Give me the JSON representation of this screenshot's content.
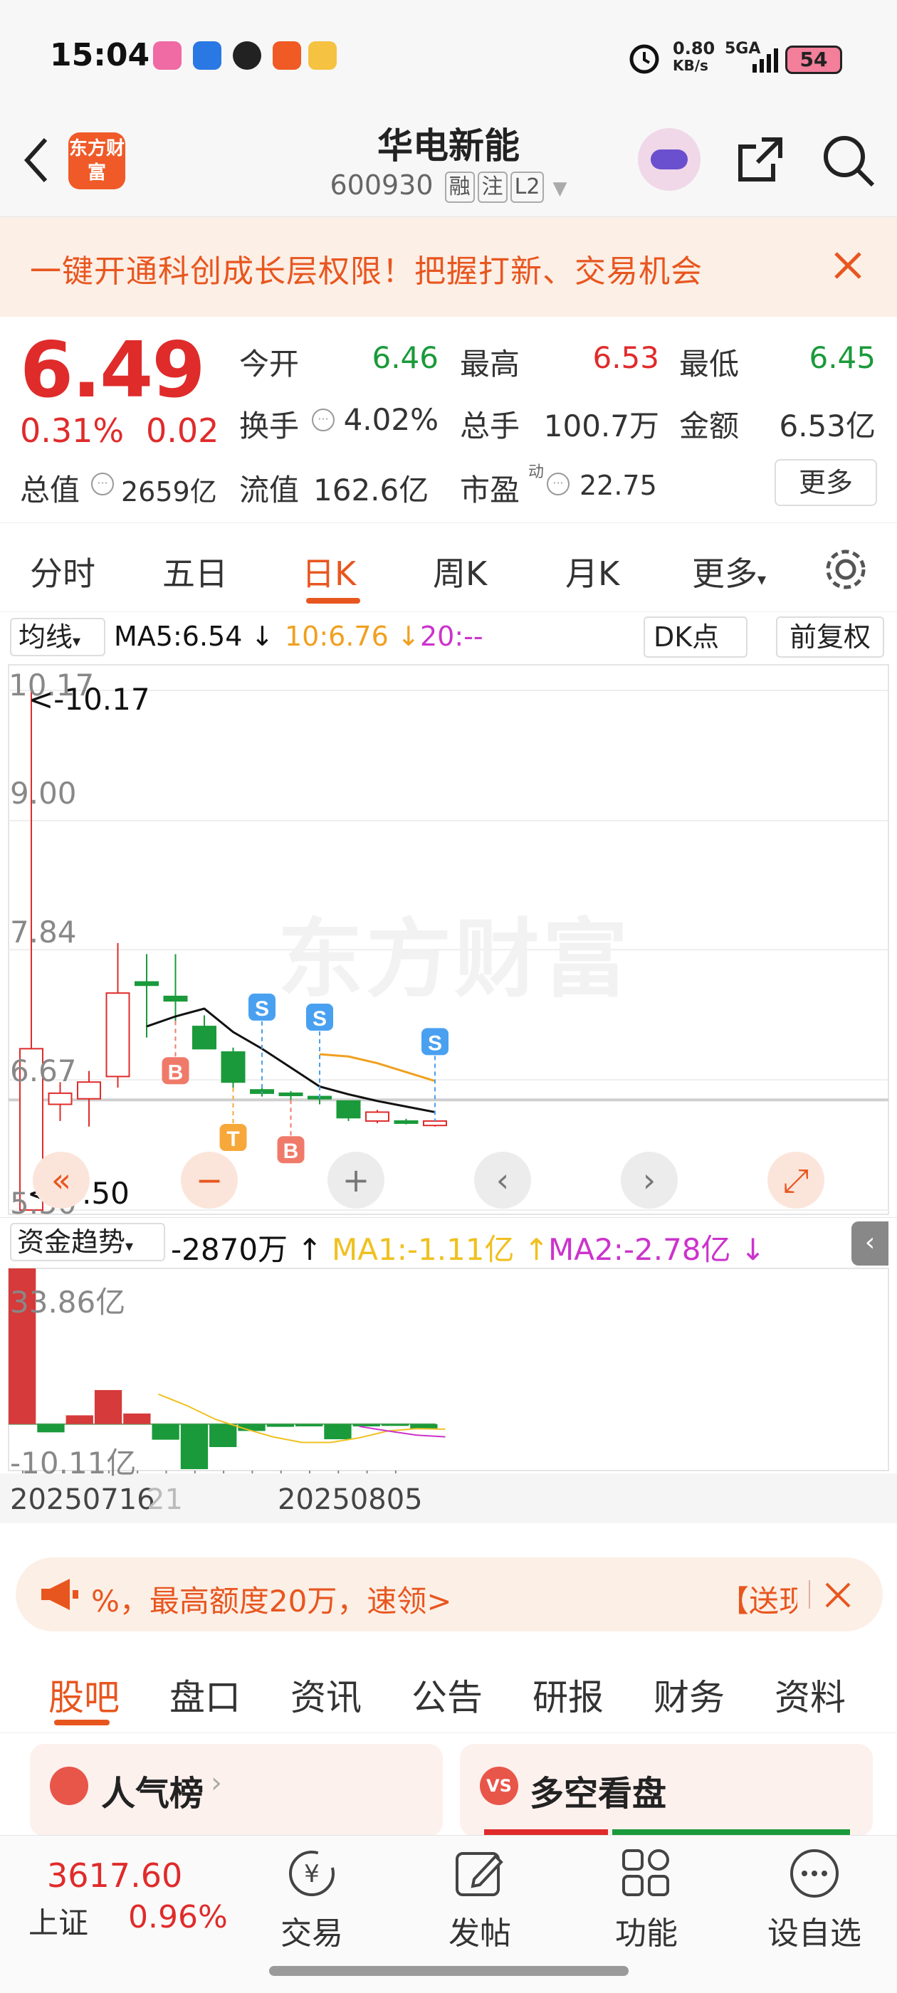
{
  "status_bar": {
    "time": "15:04",
    "net_speed": "0.80",
    "net_unit": "KB/s",
    "signal": "5GA",
    "battery": "54"
  },
  "header": {
    "stock_name": "华电新能",
    "stock_code": "600930",
    "tags": [
      "融",
      "注",
      "L2"
    ],
    "logo_text": "东方财富"
  },
  "banner": {
    "text": "一键开通科创成长层权限！把握打新、交易机会"
  },
  "quote": {
    "price": "6.49",
    "change_pct": "0.31%",
    "change": "0.02",
    "open_label": "今开",
    "open": "6.46",
    "high_label": "最高",
    "high": "6.53",
    "low_label": "最低",
    "low": "6.45",
    "turnover_label": "换手",
    "turnover": "4.02%",
    "volume_label": "总手",
    "volume": "100.7万",
    "amount_label": "金额",
    "amount": "6.53亿",
    "mktcap_label": "总值",
    "mktcap": "2659亿",
    "float_label": "流值",
    "float": "162.6亿",
    "pe_label": "市盈",
    "pe_sup": "动",
    "pe": "22.75",
    "more": "更多"
  },
  "chart_tabs": [
    "分时",
    "五日",
    "日K",
    "周K",
    "月K",
    "更多"
  ],
  "chart_tabs_active": "日K",
  "ma_bar": {
    "selector": "均线",
    "ma5": "MA5:6.54",
    "ma10": "10:6.76",
    "ma20": "20:--",
    "dk": "DK点",
    "adjust": "前复权"
  },
  "kline": {
    "y_ticks": [
      "10.17",
      "9.00",
      "7.84",
      "6.67",
      "5.50"
    ],
    "max_label": "<-10.17",
    "min_label": "<-5.50",
    "watermark": "东方财富",
    "markers": {
      "buy": "B",
      "sell": "S",
      "t": "T"
    },
    "controls": [
      "«",
      "−",
      "+",
      "‹",
      "›",
      "⤢"
    ]
  },
  "fund_bar": {
    "selector": "资金趋势",
    "value": "-2870万",
    "ma1": "MA1:-1.11亿",
    "ma2": "MA2:-2.78亿"
  },
  "fund_chart": {
    "top_label": "33.86亿",
    "bottom_label": "-10.11亿",
    "date_start": "20250716",
    "date_start_tail": "21",
    "date_mid": "20250805"
  },
  "chart_data": [
    {
      "type": "candlestick",
      "ylim": [
        5.5,
        10.17
      ],
      "y_ticks": [
        10.17,
        9.0,
        7.84,
        6.67,
        5.5
      ],
      "candles": [
        {
          "o": 5.5,
          "h": 10.17,
          "l": 5.5,
          "c": 6.95
        },
        {
          "o": 6.45,
          "h": 6.65,
          "l": 6.3,
          "c": 6.55
        },
        {
          "o": 6.5,
          "h": 6.75,
          "l": 6.25,
          "c": 6.65
        },
        {
          "o": 6.7,
          "h": 7.9,
          "l": 6.6,
          "c": 7.45
        },
        {
          "o": 7.55,
          "h": 7.8,
          "l": 7.05,
          "c": 7.52
        },
        {
          "o": 7.42,
          "h": 7.8,
          "l": 7.2,
          "c": 7.38
        },
        {
          "o": 7.15,
          "h": 7.25,
          "l": 6.95,
          "c": 6.95
        },
        {
          "o": 6.92,
          "h": 6.96,
          "l": 6.6,
          "c": 6.65
        },
        {
          "o": 6.58,
          "h": 6.62,
          "l": 6.52,
          "c": 6.55
        },
        {
          "o": 6.55,
          "h": 6.57,
          "l": 6.49,
          "c": 6.53
        },
        {
          "o": 6.52,
          "h": 6.53,
          "l": 6.45,
          "c": 6.5
        },
        {
          "o": 6.48,
          "h": 6.48,
          "l": 6.3,
          "c": 6.33
        },
        {
          "o": 6.3,
          "h": 6.4,
          "l": 6.28,
          "c": 6.38
        },
        {
          "o": 6.3,
          "h": 6.32,
          "l": 6.27,
          "c": 6.29
        },
        {
          "o": 6.26,
          "h": 6.31,
          "l": 6.25,
          "c": 6.3
        }
      ],
      "ma5": [
        null,
        null,
        null,
        null,
        7.15,
        7.24,
        7.31,
        7.1,
        6.95,
        6.78,
        6.61,
        6.54,
        6.48,
        6.43,
        6.38
      ],
      "ma10": [
        null,
        null,
        null,
        null,
        null,
        null,
        null,
        null,
        null,
        null,
        6.9,
        6.88,
        6.82,
        6.74,
        6.66
      ],
      "signals": [
        {
          "index": 5,
          "type": "B"
        },
        {
          "index": 7,
          "type": "T"
        },
        {
          "index": 8,
          "type": "S"
        },
        {
          "index": 9,
          "type": "B"
        },
        {
          "index": 10,
          "type": "S"
        },
        {
          "index": 14,
          "type": "S"
        }
      ],
      "colors": {
        "up": "#e02b2b",
        "down": "#1a9a3a",
        "ma5": "#111111",
        "ma10": "#f0a020"
      }
    },
    {
      "type": "bar",
      "ylim": [
        -10.11,
        33.86
      ],
      "values": [
        33.86,
        -1.8,
        1.9,
        7.4,
        2.3,
        -3.4,
        -9.8,
        -5.0,
        -1.5,
        -0.6,
        -0.5,
        -3.3,
        -0.5,
        -0.4,
        -1.0
      ],
      "ma1": [
        null,
        6.5,
        4.0,
        1.0,
        -1.0,
        -2.8,
        -4.0,
        -4.0,
        -3.0,
        -1.5,
        -1.0,
        -1.11
      ],
      "ma2": [
        null,
        null,
        null,
        null,
        null,
        null,
        null,
        null,
        -0.5,
        -1.5,
        -2.4,
        -2.78
      ],
      "colors": {
        "pos": "#d63a3a",
        "neg": "#1a9a3a",
        "ma1": "#f0c020",
        "ma2": "#cc33cc"
      }
    }
  ],
  "promo": {
    "text": "%，最高额度20万，速领>",
    "right_text": "【送现"
  },
  "bottom_tabs": [
    "股吧",
    "盘口",
    "资讯",
    "公告",
    "研报",
    "财务",
    "资料"
  ],
  "bottom_tabs_active": "股吧",
  "cards": {
    "left_title": "人气榜",
    "right_title": "多空看盘",
    "right_icon": "VS"
  },
  "bottom_nav": {
    "index_value": "3617.60",
    "index_name": "上证",
    "index_change": "0.96%",
    "items": [
      "交易",
      "发帖",
      "功能",
      "设自选"
    ]
  }
}
